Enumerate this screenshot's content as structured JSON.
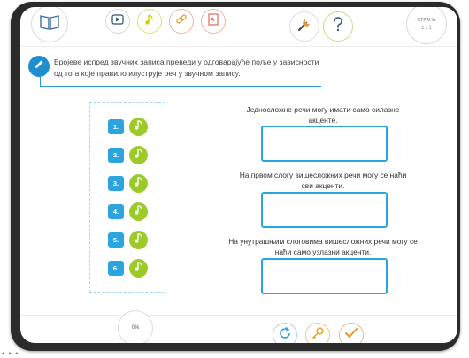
{
  "header": {
    "page_label": "СТРАНА",
    "page_number": "1 / 1",
    "tools": [
      "book-icon",
      "video-icon",
      "music-icon",
      "link-icon",
      "document-icon",
      "wrench-icon",
      "help-icon"
    ]
  },
  "instruction": "Бројеве испред звучних записа преведи у одговарајуће поље у зависности од тога које правило илуструје реч у звучном запису.",
  "audio_items": [
    "1.",
    "2.",
    "3.",
    "4.",
    "5.",
    "6."
  ],
  "answers": [
    {
      "text": "Једносложне речи могу имати само силазне акценте.",
      "value": ""
    },
    {
      "text": "На првом слогу вишесложних речи могу се наћи сви акценти.",
      "value": ""
    },
    {
      "text": "На унутрашњим слоговима вишесложних речи могу се наћи само узлазни акценти.",
      "value": ""
    }
  ],
  "footer": {
    "progress": "0%",
    "buttons": [
      "reset-icon",
      "key-icon",
      "check-icon"
    ]
  },
  "colors": {
    "accent_blue": "#2ca4e0",
    "note_green": "#9ccb29",
    "tool_yellow": "#c5d400",
    "tool_red": "#e06a5a",
    "tool_orange": "#e69a2e"
  }
}
